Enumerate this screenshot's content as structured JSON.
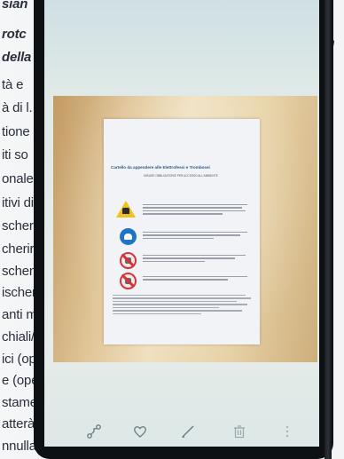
{
  "background_text_left": [
    "sian",
    "rotc",
    "della",
    "tà e",
    "à di l.",
    "tione",
    "iti so",
    "onale,",
    "itivi di",
    "scher",
    "cherir",
    "schen",
    "ischeri",
    "anti m",
    "chiali/v",
    "ici (ope",
    "e (oper",
    "stamen",
    "atterà p",
    "nnullat"
  ],
  "background_text_right": [
    "m",
    "s",
    "n",
    "el"
  ],
  "document": {
    "title": "Cartello da appendere alle Elettrofessi e Trombosei",
    "subtitle": "MISURE OBBLIGATORIE PER ACCESSO ALL'AMBIENTE"
  },
  "toolbar": {
    "share_icon": "share-icon",
    "favorite_icon": "heart-icon",
    "edit_icon": "pencil-icon",
    "delete_icon": "trash-icon",
    "more_icon": "more-vertical-icon"
  },
  "colors": {
    "warning_yellow": "#f0c020",
    "mandatory_blue": "#1f74c7",
    "prohibition_red": "#d6323a",
    "title_blue": "#2e5a8c"
  }
}
